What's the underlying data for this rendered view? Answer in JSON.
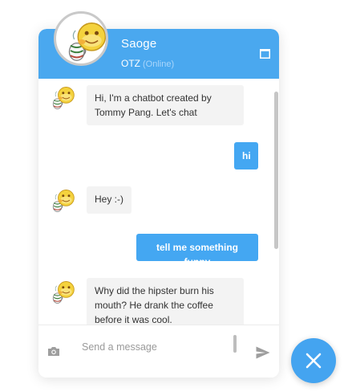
{
  "header": {
    "bot_name": "Saoge",
    "company": "OTZ",
    "status": "(Online)",
    "expand_icon": "window-maximize-icon"
  },
  "messages": [
    {
      "sender": "bot",
      "text": "Hi, I'm a chatbot created by Tommy Pang. Let's chat"
    },
    {
      "sender": "user",
      "text": "hi"
    },
    {
      "sender": "bot",
      "text": "Hey :-)"
    },
    {
      "sender": "user",
      "text": "tell me something funny"
    },
    {
      "sender": "bot",
      "text": "Why did the hipster burn his mouth? He drank the coffee before it was cool."
    }
  ],
  "composer": {
    "placeholder": "Send a message",
    "camera_icon": "camera-icon",
    "send_icon": "send-icon"
  },
  "launcher": {
    "icon": "close-icon"
  },
  "colors": {
    "accent": "#4aa8ef",
    "user_bubble": "#44a7f2",
    "bot_bubble": "#f3f3f3",
    "status_online": "#a9d6fb"
  }
}
